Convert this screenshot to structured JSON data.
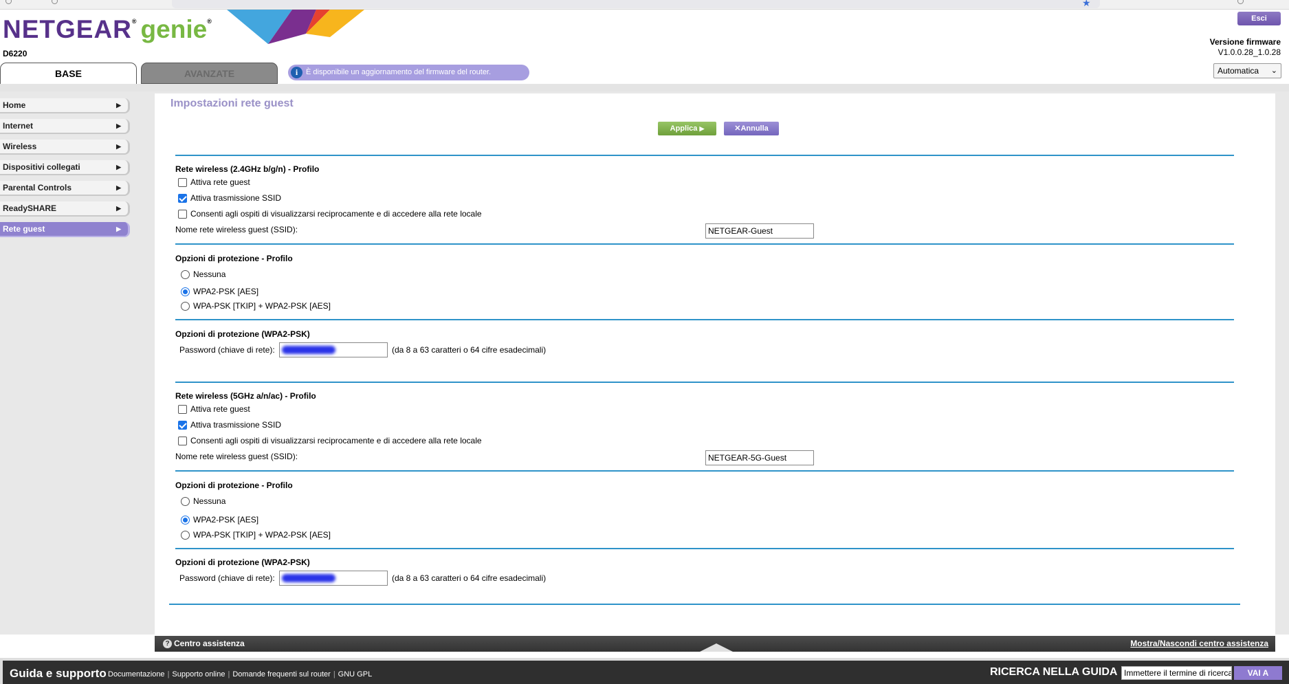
{
  "header": {
    "brand": "NETGEAR",
    "brand_reg": "®",
    "product": "genie",
    "product_reg": "®",
    "model": "D6220",
    "logout_label": "Esci",
    "firmware_label": "Versione firmware",
    "firmware_value": "V1.0.0.28_1.0.28",
    "language_selected": "Automatica",
    "notice": "È disponibile un aggiornamento del firmware del router."
  },
  "tabs": [
    {
      "label": "BASE",
      "active": true
    },
    {
      "label": "AVANZATE",
      "active": false
    }
  ],
  "sidebar": {
    "items": [
      {
        "label": "Home",
        "active": false
      },
      {
        "label": "Internet",
        "active": false
      },
      {
        "label": "Wireless",
        "active": false
      },
      {
        "label": "Dispositivi collegati",
        "active": false
      },
      {
        "label": "Parental Controls",
        "active": false
      },
      {
        "label": "ReadySHARE",
        "active": false
      },
      {
        "label": "Rete guest",
        "active": true
      }
    ]
  },
  "main": {
    "title": "Impostazioni rete guest",
    "apply_label": "Applica",
    "apply_arrow": "▶",
    "cancel_label": "Annulla",
    "cancel_icon": "✕",
    "band_24": {
      "profile_title": "Rete wireless (2.4GHz b/g/n) - Profilo",
      "enable_guest": {
        "label": "Attiva rete guest",
        "checked": false
      },
      "broadcast_ssid": {
        "label": "Attiva trasmissione SSID",
        "checked": true
      },
      "allow_local": {
        "label": "Consenti agli ospiti di visualizzarsi reciprocamente e di accedere alla rete locale",
        "checked": false
      },
      "ssid_label": "Nome rete wireless guest (SSID):",
      "ssid_value": "NETGEAR-Guest",
      "security_title": "Opzioni di protezione - Profilo",
      "security_options": [
        {
          "label": "Nessuna",
          "selected": false
        },
        {
          "label": "WPA2-PSK [AES]",
          "selected": true
        },
        {
          "label": "WPA-PSK [TKIP] + WPA2-PSK [AES]",
          "selected": false
        }
      ],
      "psk_title": "Opzioni di protezione (WPA2-PSK)",
      "password_label": "Password (chiave di rete):",
      "password_hint": "(da 8 a 63 caratteri o 64 cifre esadecimali)"
    },
    "band_5": {
      "profile_title": "Rete wireless (5GHz a/n/ac) - Profilo",
      "enable_guest": {
        "label": "Attiva rete guest",
        "checked": false
      },
      "broadcast_ssid": {
        "label": "Attiva trasmissione SSID",
        "checked": true
      },
      "allow_local": {
        "label": "Consenti agli ospiti di visualizzarsi reciprocamente e di accedere alla rete locale",
        "checked": false
      },
      "ssid_label": "Nome rete wireless guest (SSID):",
      "ssid_value": "NETGEAR-5G-Guest",
      "security_title": "Opzioni di protezione - Profilo",
      "security_options": [
        {
          "label": "Nessuna",
          "selected": false
        },
        {
          "label": "WPA2-PSK [AES]",
          "selected": true
        },
        {
          "label": "WPA-PSK [TKIP] + WPA2-PSK [AES]",
          "selected": false
        }
      ],
      "psk_title": "Opzioni di protezione (WPA2-PSK)",
      "password_label": "Password (chiave di rete):",
      "password_hint": "(da 8 a 63 caratteri o 64 cifre esadecimali)"
    }
  },
  "help_bar": {
    "label": "Centro assistenza",
    "toggle": "Mostra/Nascondi centro assistenza"
  },
  "footer": {
    "title": "Guida e supporto",
    "links": [
      "Documentazione",
      "Supporto online",
      "Domande frequenti sul router",
      "GNU GPL"
    ],
    "search_label": "RICERCA NELLA GUIDA",
    "search_placeholder": "Immettere il termine di ricerca",
    "go_label": "VAI A"
  },
  "colors": {
    "accent_purple": "#8f82cf",
    "brand_purple": "#57318a",
    "genie_green": "#78b843",
    "divider_blue": "#2e93c9",
    "apply_green": "#6fa03b"
  }
}
